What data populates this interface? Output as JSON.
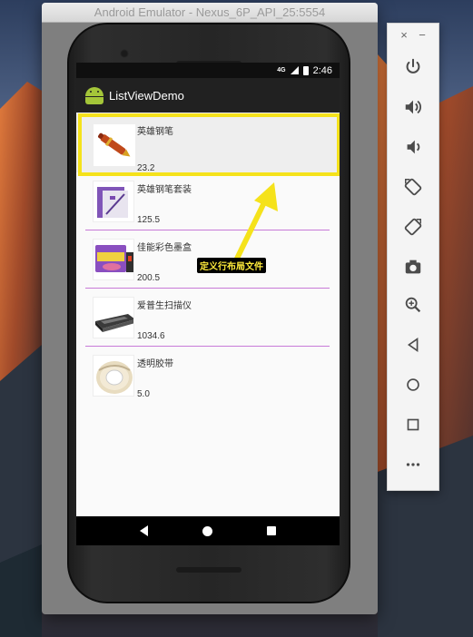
{
  "emulator": {
    "window_title": "Android Emulator - Nexus_6P_API_25:5554"
  },
  "status_bar": {
    "network": "4G",
    "time": "2:46"
  },
  "app": {
    "title": "ListViewDemo"
  },
  "products": [
    {
      "name": "英雄钢笔",
      "price": "23.2",
      "image": "fountain-pen-image"
    },
    {
      "name": "英雄钢笔套装",
      "price": "125.5",
      "image": "pen-gift-set-image"
    },
    {
      "name": "佳能彩色墨盒",
      "price": "200.5",
      "image": "ink-cartridge-image"
    },
    {
      "name": "爱普生扫描仪",
      "price": "1034.6",
      "image": "scanner-image"
    },
    {
      "name": "透明胶带",
      "price": "5.0",
      "image": "tape-roll-image"
    }
  ],
  "annotation": {
    "label": "定义行布局文件",
    "highlight_color": "#f5e21b"
  },
  "toolbar": {
    "close_label": "×",
    "minimize_label": "−",
    "buttons": [
      "power-icon",
      "volume-up-icon",
      "volume-down-icon",
      "rotate-left-icon",
      "rotate-right-icon",
      "camera-icon",
      "zoom-icon",
      "back-icon",
      "home-icon",
      "overview-icon",
      "more-icon"
    ]
  },
  "colors": {
    "divider": "#c77ad8",
    "app_bar": "#212121",
    "android_green": "#a4c639"
  }
}
